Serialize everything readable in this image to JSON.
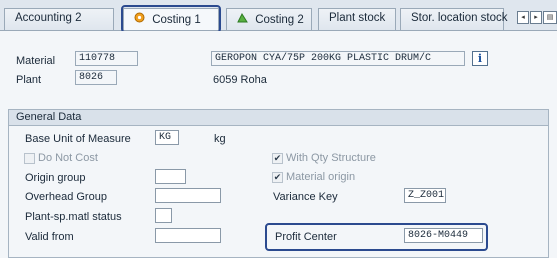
{
  "tabs": [
    {
      "label": "Accounting 2",
      "icon": "",
      "active": false
    },
    {
      "label": "Costing 1",
      "icon": "costing-icon",
      "active": true
    },
    {
      "label": "Costing 2",
      "icon": "costing-icon",
      "active": false
    },
    {
      "label": "Plant stock",
      "icon": "",
      "active": false
    },
    {
      "label": "Stor. location stock",
      "icon": "",
      "active": false
    }
  ],
  "nav": {
    "left": "◂",
    "right": "▸",
    "list": "▤"
  },
  "header": {
    "material_label": "Material",
    "material_value": "110778",
    "material_desc": "GEROPON CYA/75P 200KG PLASTIC DRUM/C",
    "info_button": "i",
    "plant_label": "Plant",
    "plant_value": "8026",
    "plant_desc": "6059 Roha"
  },
  "general": {
    "title": "General Data",
    "base_uom_label": "Base Unit of Measure",
    "base_uom_value": "KG",
    "base_uom_text": "kg",
    "do_not_cost_label": "Do Not Cost",
    "with_qty_label": "With Qty Structure",
    "with_qty_check": "✔",
    "origin_group_label": "Origin group",
    "material_origin_label": "Material origin",
    "material_origin_check": "✔",
    "overhead_group_label": "Overhead Group",
    "variance_key_label": "Variance Key",
    "variance_key_value": "Z_Z001",
    "plant_sp_label": "Plant-sp.matl status",
    "valid_from_label": "Valid from",
    "profit_center_label": "Profit Center",
    "profit_center_value": "8026-M0449"
  },
  "colors": {
    "highlight": "#2b4a8f",
    "group_header": "#d9e1ea"
  }
}
